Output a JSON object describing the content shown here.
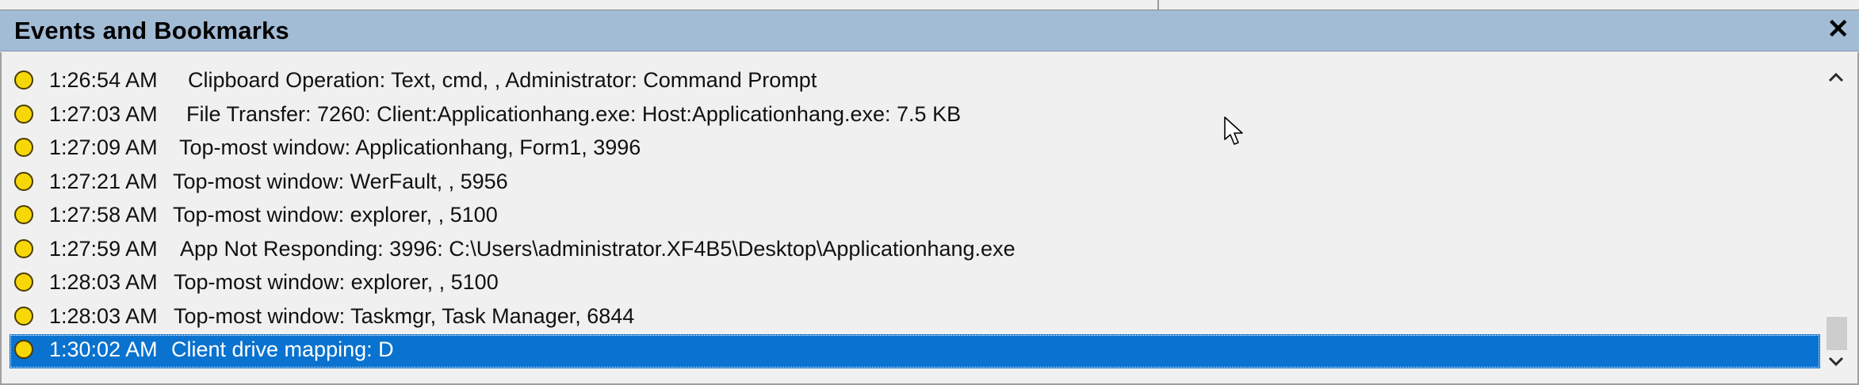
{
  "window": {
    "title": "Events and Bookmarks",
    "close_glyph": "✕"
  },
  "events": [
    {
      "time": "1:26:54 AM",
      "message": "Clipboard Operation: Text, cmd, , Administrator: Command Prompt",
      "selected": false
    },
    {
      "time": "1:27:03 AM",
      "message": "File Transfer: 7260: Client:Applicationhang.exe: Host:Applicationhang.exe: 7.5 KB",
      "selected": false
    },
    {
      "time": "1:27:09 AM",
      "message": "Top-most window: Applicationhang, Form1, 3996",
      "selected": false
    },
    {
      "time": "1:27:21 AM",
      "message": "Top-most window: WerFault, , 5956",
      "selected": false
    },
    {
      "time": "1:27:58 AM",
      "message": "Top-most window: explorer, , 5100",
      "selected": false
    },
    {
      "time": "1:27:59 AM",
      "message": "App Not Responding: 3996: C:\\Users\\administrator.XF4B5\\Desktop\\Applicationhang.exe",
      "selected": false
    },
    {
      "time": "1:28:03 AM",
      "message": "Top-most window: explorer, , 5100",
      "selected": false
    },
    {
      "time": "1:28:03 AM",
      "message": "Top-most window: Taskmgr, Task Manager, 6844",
      "selected": false
    },
    {
      "time": "1:30:02 AM",
      "message": "Client drive mapping: D",
      "selected": true
    }
  ],
  "icons": {
    "event": "yellow-circle-icon",
    "close": "close-icon",
    "scroll_up": "chevron-up-icon",
    "scroll_down": "chevron-down-icon"
  },
  "colors": {
    "titlebar": "#a3bcd6",
    "selection": "#0a72cf",
    "event_dot": "#f7d708"
  }
}
